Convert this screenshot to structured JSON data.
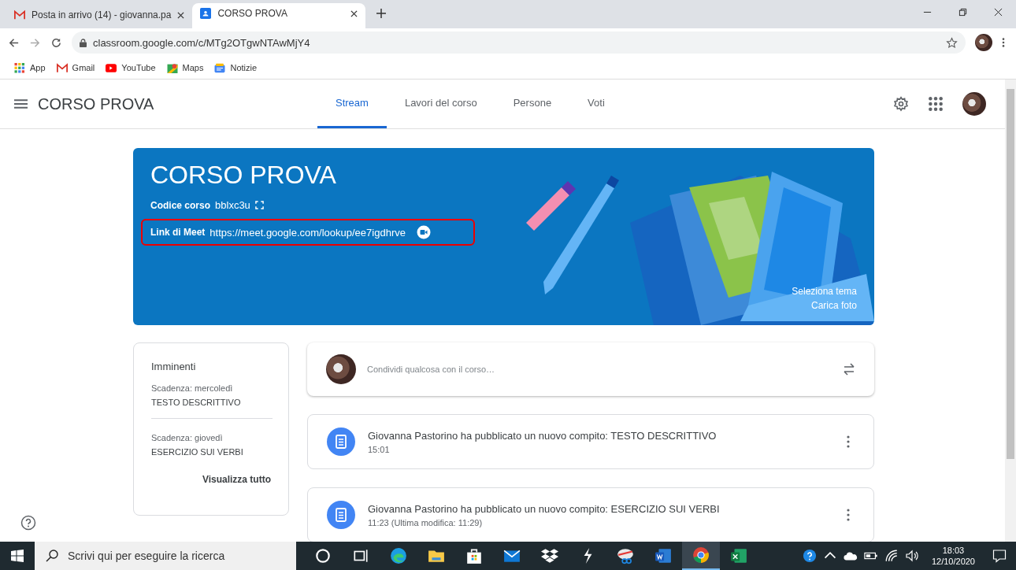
{
  "browser": {
    "tabs": [
      {
        "title": "Posta in arrivo (14) - giovanna.pa",
        "kind": "mail",
        "selected": false
      },
      {
        "title": "CORSO PROVA",
        "kind": "classroom",
        "selected": true
      }
    ],
    "address": "classroom.google.com/c/MTg2OTgwNTAwMjY4",
    "bookmarks": [
      {
        "label": "App",
        "kind": "apps"
      },
      {
        "label": "Gmail",
        "kind": "mail"
      },
      {
        "label": "YouTube",
        "kind": "video"
      },
      {
        "label": "Maps",
        "kind": "map"
      },
      {
        "label": "Notizie",
        "kind": "news"
      }
    ]
  },
  "header": {
    "title": "CORSO PROVA",
    "tabs": [
      {
        "label": "Stream",
        "selected": true
      },
      {
        "label": "Lavori del corso",
        "selected": false
      },
      {
        "label": "Persone",
        "selected": false
      },
      {
        "label": "Voti",
        "selected": false
      }
    ]
  },
  "banner": {
    "title": "CORSO PROVA",
    "code_label": "Codice corso",
    "code": "bblxc3u",
    "meet_label": "Link di Meet",
    "meet_link": "https://meet.google.com/lookup/ee7igdhrve",
    "highlighted": true,
    "links": [
      "Seleziona tema",
      "Carica foto"
    ]
  },
  "upcoming": {
    "title": "Imminenti",
    "items": [
      {
        "due": "Scadenza: mercoledì",
        "task": "TESTO DESCRITTIVO"
      },
      {
        "due": "Scadenza: giovedì",
        "task": "ESERCIZIO SUI VERBI"
      }
    ],
    "view_all": "Visualizza tutto"
  },
  "share": {
    "placeholder": "Condividi qualcosa con il corso…"
  },
  "posts": [
    {
      "text": "Giovanna Pastorino ha pubblicato un nuovo compito: TESTO DESCRITTIVO",
      "time": "15:01"
    },
    {
      "text": "Giovanna Pastorino ha pubblicato un nuovo compito: ESERCIZIO SUI VERBI",
      "time": "11:23 (Ultima modifica: 11:29)"
    }
  ],
  "taskbar": {
    "search_placeholder": "Scrivi qui per eseguire la ricerca",
    "apps": [
      {
        "kind": "cortana",
        "selected": false
      },
      {
        "kind": "taskview",
        "selected": false
      },
      {
        "kind": "edge",
        "selected": false
      },
      {
        "kind": "folder",
        "selected": false
      },
      {
        "kind": "store",
        "selected": false
      },
      {
        "kind": "mail",
        "selected": false
      },
      {
        "kind": "dropbox",
        "selected": false
      },
      {
        "kind": "bolt",
        "selected": false
      },
      {
        "kind": "snip",
        "selected": false
      },
      {
        "kind": "word",
        "selected": false
      },
      {
        "kind": "chrome",
        "selected": true
      },
      {
        "kind": "excel",
        "selected": false
      }
    ],
    "time": "18:03",
    "date": "12/10/2020"
  }
}
